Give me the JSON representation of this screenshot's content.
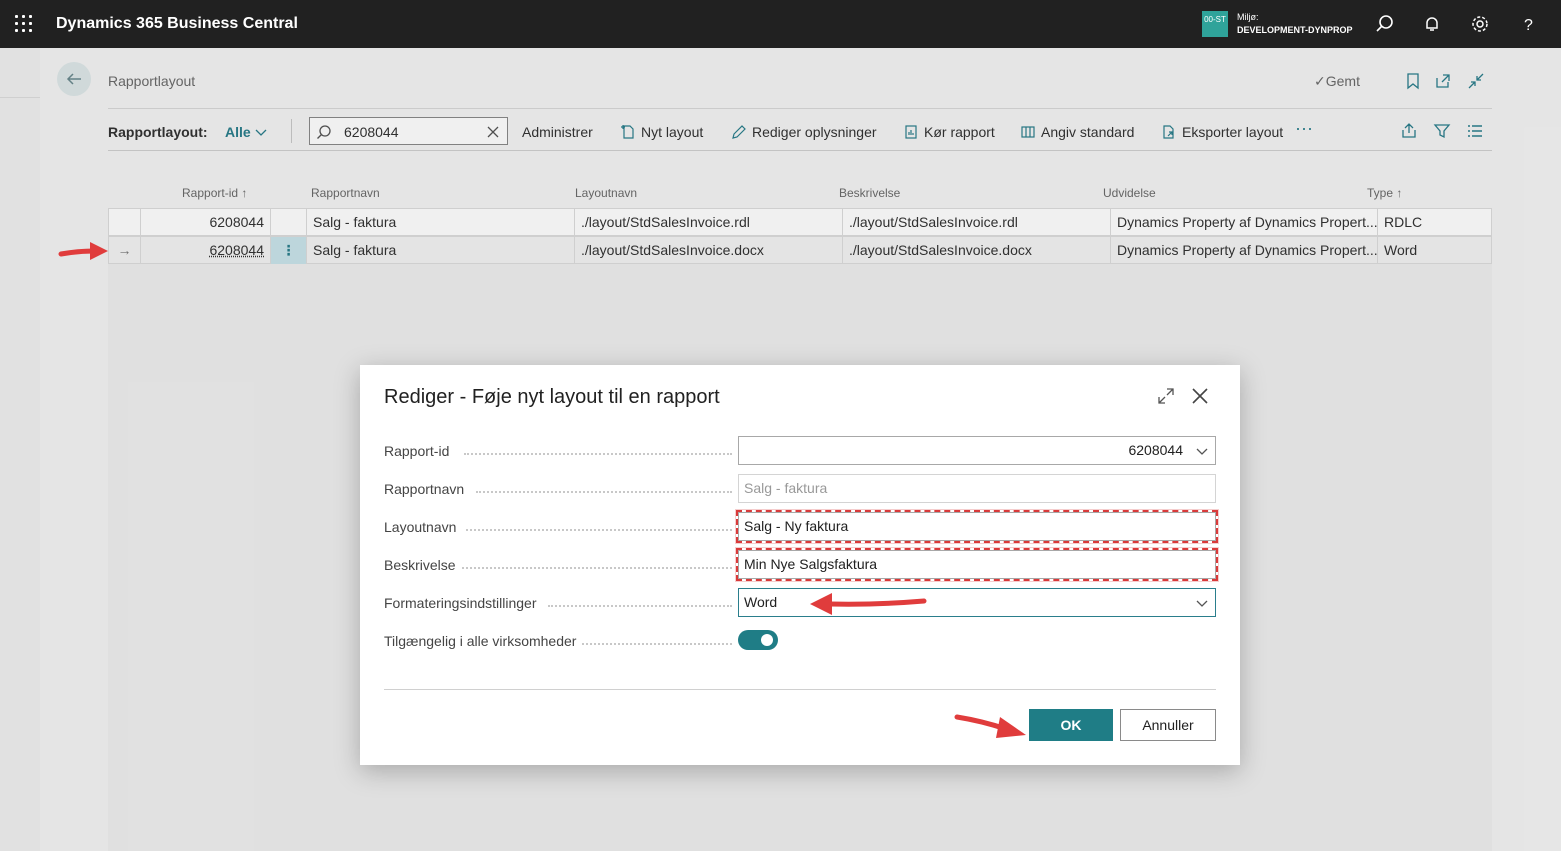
{
  "topbar": {
    "title": "Dynamics 365 Business Central",
    "env_badge": "00-ST",
    "env_label": "Miljø:",
    "env_name": "DEVELOPMENT-DYNPROP"
  },
  "page": {
    "title": "Rapportlayout",
    "saved": "Gemt"
  },
  "actionbar": {
    "view_label": "Rapportlayout:",
    "view_value": "Alle",
    "search_value": "6208044",
    "actions": [
      "Administrer",
      "Nyt layout",
      "Rediger oplysninger",
      "Kør rapport",
      "Angiv standard",
      "Eksporter layout"
    ]
  },
  "table": {
    "columns": [
      "Rapport-id",
      "Rapportnavn",
      "Layoutnavn",
      "Beskrivelse",
      "Udvidelse",
      "Type"
    ],
    "rows": [
      {
        "id": "6208044",
        "name": "Salg - faktura",
        "layout": "./layout/StdSalesInvoice.rdl",
        "desc": "./layout/StdSalesInvoice.rdl",
        "ext": "Dynamics Property af Dynamics Propert...",
        "type": "RDLC"
      },
      {
        "id": "6208044",
        "name": "Salg - faktura",
        "layout": "./layout/StdSalesInvoice.docx",
        "desc": "./layout/StdSalesInvoice.docx",
        "ext": "Dynamics Property af Dynamics Propert...",
        "type": "Word"
      }
    ]
  },
  "dialog": {
    "title": "Rediger - Føje nyt layout til en rapport",
    "fields": {
      "report_id": {
        "label": "Rapport-id",
        "value": "6208044"
      },
      "report_name": {
        "label": "Rapportnavn",
        "placeholder": "Salg - faktura"
      },
      "layout_name": {
        "label": "Layoutnavn",
        "value": "Salg - Ny faktura"
      },
      "description": {
        "label": "Beskrivelse",
        "value": "Min Nye Salgsfaktura"
      },
      "format": {
        "label": "Formateringsindstillinger",
        "value": "Word"
      },
      "available_all": {
        "label": "Tilgængelig i alle virksomheder",
        "checked": true
      }
    },
    "ok_label": "OK",
    "cancel_label": "Annuller"
  },
  "colors": {
    "accent": "#1f7d86",
    "topbar": "#212121",
    "annotation": "#e03c3c"
  }
}
